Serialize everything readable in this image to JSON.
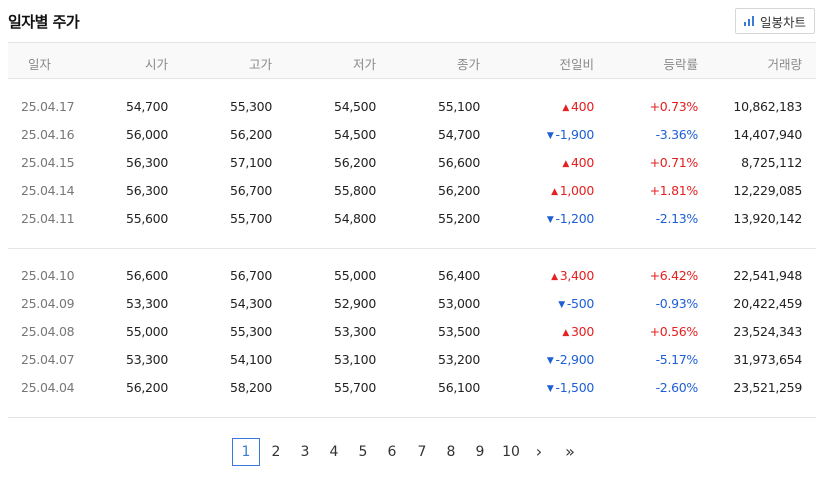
{
  "title": "일자별 주가",
  "chart_button": {
    "label": "일봉차트",
    "icon": "bar-chart-icon"
  },
  "columns": [
    "일자",
    "시가",
    "고가",
    "저가",
    "종가",
    "전일비",
    "등락률",
    "거래량"
  ],
  "colors": {
    "up": "#e52020",
    "down": "#1e5fd6",
    "accent": "#3b7ad9"
  },
  "rows": [
    {
      "date": "25.04.17",
      "open": "54,700",
      "high": "55,300",
      "low": "54,500",
      "close": "55,100",
      "dir": "up",
      "change": "400",
      "rate": "+0.73%",
      "volume": "10,862,183"
    },
    {
      "date": "25.04.16",
      "open": "56,000",
      "high": "56,200",
      "low": "54,500",
      "close": "54,700",
      "dir": "down",
      "change": "-1,900",
      "rate": "-3.36%",
      "volume": "14,407,940"
    },
    {
      "date": "25.04.15",
      "open": "56,300",
      "high": "57,100",
      "low": "56,200",
      "close": "56,600",
      "dir": "up",
      "change": "400",
      "rate": "+0.71%",
      "volume": "8,725,112"
    },
    {
      "date": "25.04.14",
      "open": "56,300",
      "high": "56,700",
      "low": "55,800",
      "close": "56,200",
      "dir": "up",
      "change": "1,000",
      "rate": "+1.81%",
      "volume": "12,229,085"
    },
    {
      "date": "25.04.11",
      "open": "55,600",
      "high": "55,700",
      "low": "54,800",
      "close": "55,200",
      "dir": "down",
      "change": "-1,200",
      "rate": "-2.13%",
      "volume": "13,920,142"
    },
    {
      "date": "25.04.10",
      "open": "56,600",
      "high": "56,700",
      "low": "55,000",
      "close": "56,400",
      "dir": "up",
      "change": "3,400",
      "rate": "+6.42%",
      "volume": "22,541,948"
    },
    {
      "date": "25.04.09",
      "open": "53,300",
      "high": "54,300",
      "low": "52,900",
      "close": "53,000",
      "dir": "down",
      "change": "-500",
      "rate": "-0.93%",
      "volume": "20,422,459"
    },
    {
      "date": "25.04.08",
      "open": "55,000",
      "high": "55,300",
      "low": "53,300",
      "close": "53,500",
      "dir": "up",
      "change": "300",
      "rate": "+0.56%",
      "volume": "23,524,343"
    },
    {
      "date": "25.04.07",
      "open": "53,300",
      "high": "54,100",
      "low": "53,100",
      "close": "53,200",
      "dir": "down",
      "change": "-2,900",
      "rate": "-5.17%",
      "volume": "31,973,654"
    },
    {
      "date": "25.04.04",
      "open": "56,200",
      "high": "58,200",
      "low": "55,700",
      "close": "56,100",
      "dir": "down",
      "change": "-1,500",
      "rate": "-2.60%",
      "volume": "23,521,259"
    }
  ],
  "pagination": {
    "pages": [
      "1",
      "2",
      "3",
      "4",
      "5",
      "6",
      "7",
      "8",
      "9",
      "10"
    ],
    "current": "1",
    "next": "›",
    "last": "»"
  }
}
